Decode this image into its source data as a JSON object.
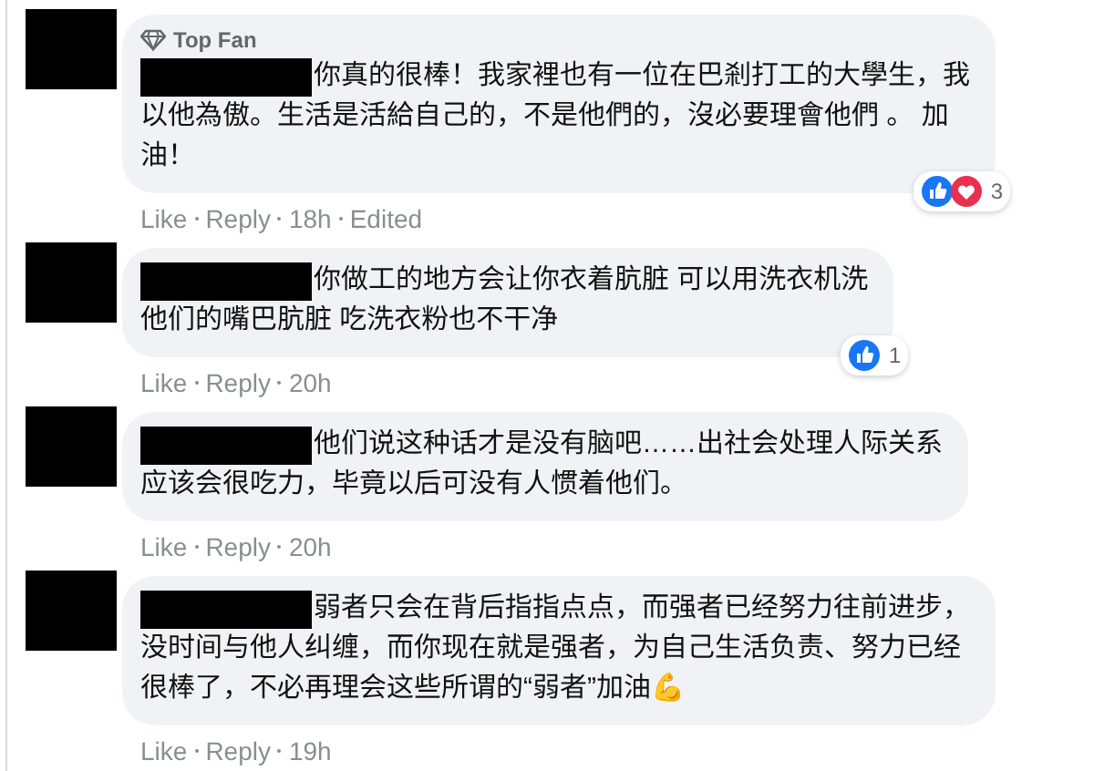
{
  "comments": [
    {
      "badge": "Top Fan",
      "name_redacted": true,
      "lines": [
        "你真的很棒！我家裡也有一位在巴剎打工的大學生，我",
        "以他為傲。生活是活給自己的，不是他們的，沒必要理會他們 。 加",
        "油！"
      ],
      "reactions": [
        {
          "kind": "like"
        },
        {
          "kind": "love"
        }
      ],
      "reaction_count": "3",
      "actions": [
        "Like",
        "Reply",
        "18h",
        "Edited"
      ]
    },
    {
      "name_redacted": true,
      "lines": [
        "你做工的地方会让你衣着肮脏 可以用洗衣机洗",
        "他们的嘴巴肮脏 吃洗衣粉也不干净"
      ],
      "reactions": [
        {
          "kind": "like"
        }
      ],
      "reaction_count": "1",
      "actions": [
        "Like",
        "Reply",
        "20h"
      ]
    },
    {
      "name_redacted": true,
      "lines": [
        "他们说这种话才是没有脑吧……出社会处理人际关系",
        "应该会很吃力，毕竟以后可没有人惯着他们。"
      ],
      "actions": [
        "Like",
        "Reply",
        "20h"
      ]
    },
    {
      "name_redacted": true,
      "lines": [
        "弱者只会在背后指指点点，而强者已经努力往前进步，",
        "没时间与他人纠缠，而你现在就是强者，为自己生活负责、努力已经",
        "很棒了，不必再理会这些所谓的“弱者”加油💪"
      ],
      "actions": [
        "Like",
        "Reply",
        "19h"
      ]
    }
  ]
}
